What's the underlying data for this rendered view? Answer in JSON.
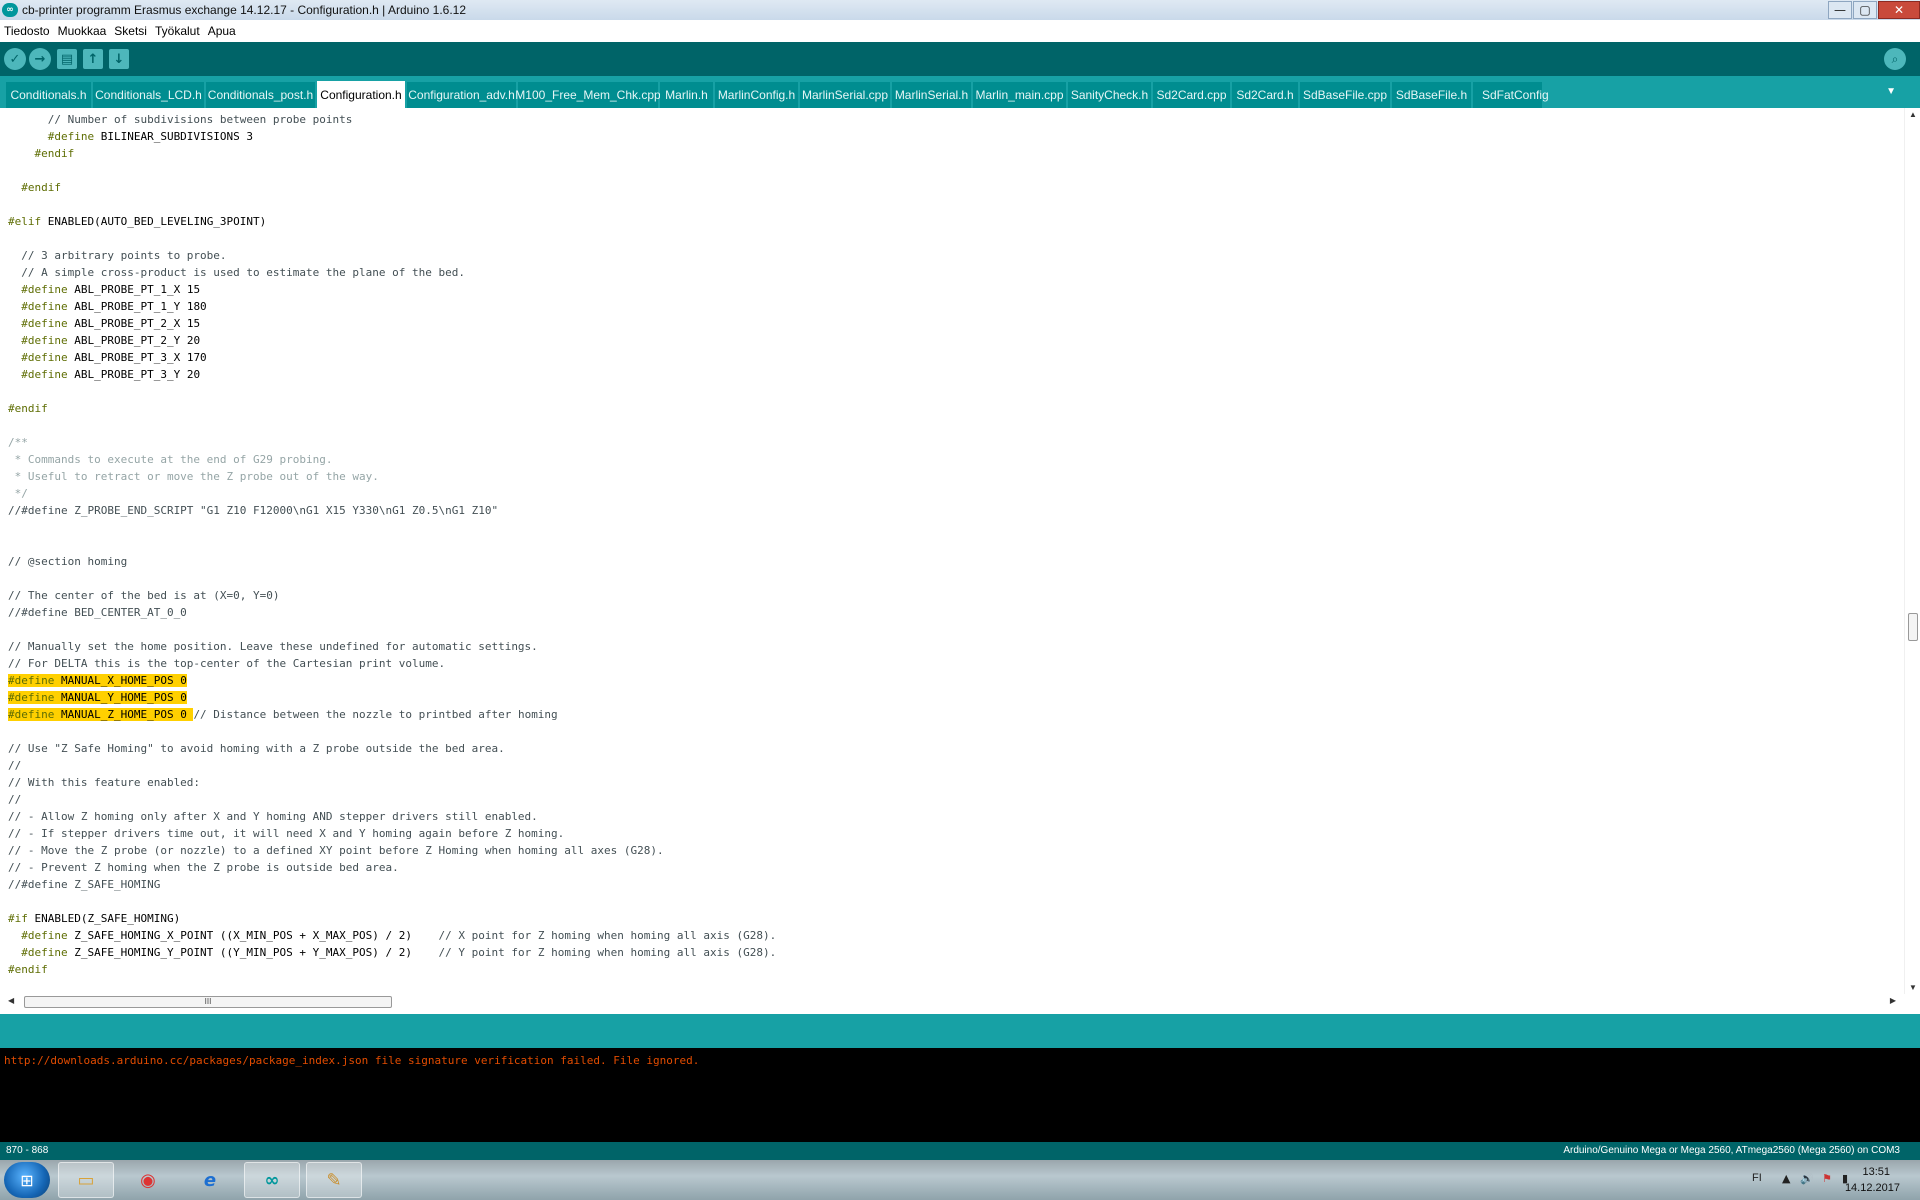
{
  "window": {
    "title": "cb-printer programm Erasmus exchange 14.12.17 - Configuration.h | Arduino 1.6.12",
    "app_icon_text": "∞",
    "minimize": "—",
    "maximize": "▢",
    "close": "✕"
  },
  "menu": [
    "Tiedosto",
    "Muokkaa",
    "Sketsi",
    "Työkalut",
    "Apua"
  ],
  "toolbar": {
    "verify": "✓",
    "upload": "→",
    "new": "▤",
    "open": "↑",
    "save": "↓",
    "serial_monitor": "⌕"
  },
  "tabs": [
    "Conditionals.h",
    "Conditionals_LCD.h",
    "Conditionals_post.h",
    "Configuration.h",
    "Configuration_adv.h",
    "M100_Free_Mem_Chk.cpp",
    "Marlin.h",
    "MarlinConfig.h",
    "MarlinSerial.cpp",
    "MarlinSerial.h",
    "Marlin_main.cpp",
    "SanityCheck.h",
    "Sd2Card.cpp",
    "Sd2Card.h",
    "SdBaseFile.cpp",
    "SdBaseFile.h",
    "SdFatConfig"
  ],
  "active_tab": "Configuration.h",
  "tab_overflow_icon": "▼",
  "code": [
    {
      "parts": [
        {
          "c": "cm",
          "t": "      // Number of subdivisions between probe points"
        }
      ]
    },
    {
      "parts": [
        {
          "c": "kw",
          "t": "      #define"
        },
        {
          "c": "",
          "t": " BILINEAR_SUBDIVISIONS 3"
        }
      ]
    },
    {
      "parts": [
        {
          "c": "kw",
          "t": "    #endif"
        }
      ]
    },
    {
      "parts": []
    },
    {
      "parts": [
        {
          "c": "kw",
          "t": "  #endif"
        }
      ]
    },
    {
      "parts": []
    },
    {
      "parts": [
        {
          "c": "kw",
          "t": "#elif"
        },
        {
          "c": "",
          "t": " ENABLED(AUTO_BED_LEVELING_3POINT)"
        }
      ]
    },
    {
      "parts": []
    },
    {
      "parts": [
        {
          "c": "cm",
          "t": "  // 3 arbitrary points to probe."
        }
      ]
    },
    {
      "parts": [
        {
          "c": "cm",
          "t": "  // A simple cross-product is used to estimate the plane of the bed."
        }
      ]
    },
    {
      "parts": [
        {
          "c": "kw",
          "t": "  #define"
        },
        {
          "c": "",
          "t": " ABL_PROBE_PT_1_X 15"
        }
      ]
    },
    {
      "parts": [
        {
          "c": "kw",
          "t": "  #define"
        },
        {
          "c": "",
          "t": " ABL_PROBE_PT_1_Y 180"
        }
      ]
    },
    {
      "parts": [
        {
          "c": "kw",
          "t": "  #define"
        },
        {
          "c": "",
          "t": " ABL_PROBE_PT_2_X 15"
        }
      ]
    },
    {
      "parts": [
        {
          "c": "kw",
          "t": "  #define"
        },
        {
          "c": "",
          "t": " ABL_PROBE_PT_2_Y 20"
        }
      ]
    },
    {
      "parts": [
        {
          "c": "kw",
          "t": "  #define"
        },
        {
          "c": "",
          "t": " ABL_PROBE_PT_3_X 170"
        }
      ]
    },
    {
      "parts": [
        {
          "c": "kw",
          "t": "  #define"
        },
        {
          "c": "",
          "t": " ABL_PROBE_PT_3_Y 20"
        }
      ]
    },
    {
      "parts": []
    },
    {
      "parts": [
        {
          "c": "kw",
          "t": "#endif"
        }
      ]
    },
    {
      "parts": []
    },
    {
      "parts": [
        {
          "c": "cm2",
          "t": "/**"
        }
      ]
    },
    {
      "parts": [
        {
          "c": "cm2",
          "t": " * Commands to execute at the end of G29 probing."
        }
      ]
    },
    {
      "parts": [
        {
          "c": "cm2",
          "t": " * Useful to retract or move the Z probe out of the way."
        }
      ]
    },
    {
      "parts": [
        {
          "c": "cm2",
          "t": " */"
        }
      ]
    },
    {
      "parts": [
        {
          "c": "cm",
          "t": "//#define Z_PROBE_END_SCRIPT \"G1 Z10 F12000\\nG1 X15 Y330\\nG1 Z0.5\\nG1 Z10\""
        }
      ]
    },
    {
      "parts": []
    },
    {
      "parts": []
    },
    {
      "parts": [
        {
          "c": "cm",
          "t": "// @section homing"
        }
      ]
    },
    {
      "parts": []
    },
    {
      "parts": [
        {
          "c": "cm",
          "t": "// The center of the bed is at (X=0, Y=0)"
        }
      ]
    },
    {
      "parts": [
        {
          "c": "cm",
          "t": "//#define BED_CENTER_AT_0_0"
        }
      ]
    },
    {
      "parts": []
    },
    {
      "parts": [
        {
          "c": "cm",
          "t": "// Manually set the home position. Leave these undefined for automatic settings."
        }
      ]
    },
    {
      "parts": [
        {
          "c": "cm",
          "t": "// For DELTA this is the top-center of the Cartesian print volume."
        }
      ]
    },
    {
      "parts": [
        {
          "c": "hl kw",
          "t": "#define"
        },
        {
          "c": "hl",
          "t": " MANUAL_X_HOME_POS 0"
        }
      ]
    },
    {
      "parts": [
        {
          "c": "hl kw",
          "t": "#define"
        },
        {
          "c": "hl",
          "t": " MANUAL_Y_HOME_POS 0"
        }
      ]
    },
    {
      "parts": [
        {
          "c": "hl kw",
          "t": "#define"
        },
        {
          "c": "hl",
          "t": " MANUAL_Z_HOME_POS 0 "
        },
        {
          "c": "cm",
          "t": "// Distance between the nozzle to printbed after homing"
        }
      ]
    },
    {
      "parts": []
    },
    {
      "parts": [
        {
          "c": "cm",
          "t": "// Use \"Z Safe Homing\" to avoid homing with a Z probe outside the bed area."
        }
      ]
    },
    {
      "parts": [
        {
          "c": "cm",
          "t": "//"
        }
      ]
    },
    {
      "parts": [
        {
          "c": "cm",
          "t": "// With this feature enabled:"
        }
      ]
    },
    {
      "parts": [
        {
          "c": "cm",
          "t": "//"
        }
      ]
    },
    {
      "parts": [
        {
          "c": "cm",
          "t": "// - Allow Z homing only after X and Y homing AND stepper drivers still enabled."
        }
      ]
    },
    {
      "parts": [
        {
          "c": "cm",
          "t": "// - If stepper drivers time out, it will need X and Y homing again before Z homing."
        }
      ]
    },
    {
      "parts": [
        {
          "c": "cm",
          "t": "// - Move the Z probe (or nozzle) to a defined XY point before Z Homing when homing all axes (G28)."
        }
      ]
    },
    {
      "parts": [
        {
          "c": "cm",
          "t": "// - Prevent Z homing when the Z probe is outside bed area."
        }
      ]
    },
    {
      "parts": [
        {
          "c": "cm",
          "t": "//#define Z_SAFE_HOMING"
        }
      ]
    },
    {
      "parts": []
    },
    {
      "parts": [
        {
          "c": "kw",
          "t": "#if"
        },
        {
          "c": "",
          "t": " ENABLED(Z_SAFE_HOMING)"
        }
      ]
    },
    {
      "parts": [
        {
          "c": "kw",
          "t": "  #define"
        },
        {
          "c": "",
          "t": " Z_SAFE_HOMING_X_POINT ((X_MIN_POS + X_MAX_POS) / 2)    "
        },
        {
          "c": "cm",
          "t": "// X point for Z homing when homing all axis (G28)."
        }
      ]
    },
    {
      "parts": [
        {
          "c": "kw",
          "t": "  #define"
        },
        {
          "c": "",
          "t": " Z_SAFE_HOMING_Y_POINT ((Y_MIN_POS + Y_MAX_POS) / 2)    "
        },
        {
          "c": "cm",
          "t": "// Y point for Z homing when homing all axis (G28)."
        }
      ]
    },
    {
      "parts": [
        {
          "c": "kw",
          "t": "#endif"
        }
      ]
    }
  ],
  "scroll": {
    "up": "▲",
    "down": "▼",
    "left": "◀",
    "right": "▶",
    "grip": "III",
    "vgrip": "≡"
  },
  "console": {
    "message": "http://downloads.arduino.cc/packages/package_index.json file signature verification failed. File ignored."
  },
  "status": {
    "line": "870 - 868",
    "board": "Arduino/Genuino Mega or Mega 2560, ATmega2560 (Mega 2560) on COM3"
  },
  "taskbar": {
    "start_icon": "⊞",
    "apps": [
      {
        "name": "explorer",
        "glyph": "▭",
        "open": true
      },
      {
        "name": "chrome",
        "glyph": "◉",
        "open": false
      },
      {
        "name": "internet-explorer",
        "glyph": "e",
        "open": false
      },
      {
        "name": "arduino",
        "glyph": "∞",
        "open": true
      },
      {
        "name": "paint",
        "glyph": "✎",
        "open": true
      }
    ],
    "language": "FI",
    "time": "13:51",
    "date": "14.12.2017",
    "tray_icons": [
      "▲",
      "🔊",
      "⚑",
      "▮"
    ]
  }
}
